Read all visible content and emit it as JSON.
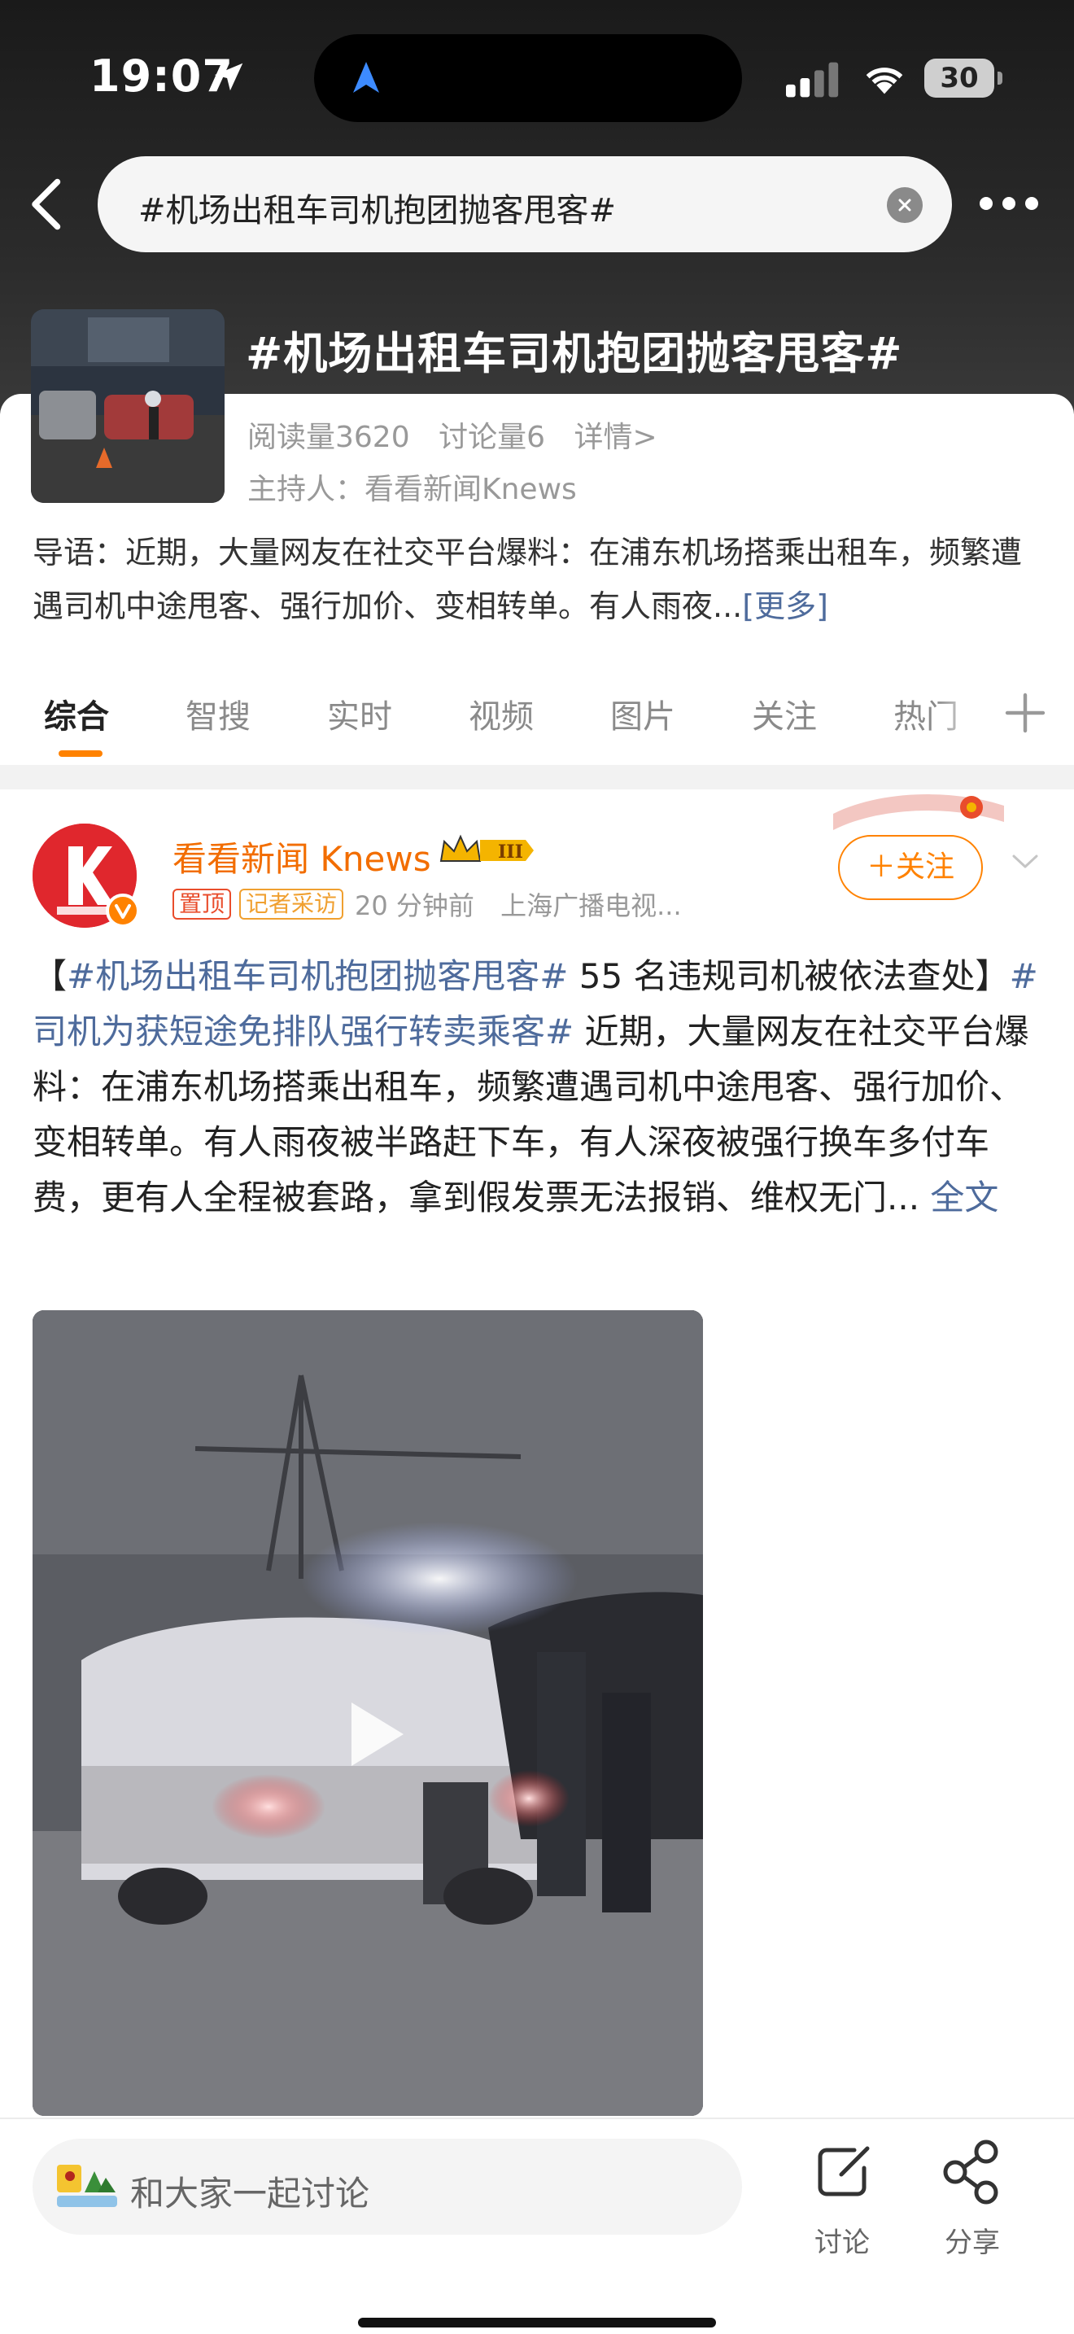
{
  "status_bar": {
    "time": "19:07",
    "battery": "30"
  },
  "search": {
    "query": "#机场出租车司机抱团抛客甩客#"
  },
  "topic": {
    "title": "#机场出租车司机抱团抛客甩客#",
    "reads": "阅读量3620",
    "discussions": "讨论量6",
    "details": "详情>",
    "host": "主持人：看看新闻Knews",
    "intro": "导语：近期，大量网友在社交平台爆料：在浦东机场搭乘出租车，频繁遭遇司机中途甩客、强行加价、变相转单。有人雨夜...",
    "more": "[更多]"
  },
  "tabs": [
    "综合",
    "智搜",
    "实时",
    "视频",
    "图片",
    "关注",
    "热门"
  ],
  "post": {
    "author": "看看新闻 Knews",
    "tag_pinned": "置顶",
    "tag_reporter": "记者采访",
    "time": "20 分钟前",
    "source": "上海广播电视...",
    "follow": "＋关注",
    "text_open": "【",
    "hashtag1": "#机场出租车司机抱团抛客甩客#",
    "text1": " 55 名违规司机被依法查处】",
    "hashtag2": "#司机为获短途免排队强行转卖乘客#",
    "text2": " 近期，大量网友在社交平台爆料：在浦东机场搭乘出租车，频繁遭遇司机中途甩客、强行加价、变相转单。有人雨夜被半路赶下车，有人深夜被强行换车多付车费，更有人全程被套路，拿到假发票无法报销、维权无门...",
    "full_text": " 全文"
  },
  "bottom_bar": {
    "comment_placeholder": "和大家一起讨论",
    "discuss": "讨论",
    "share": "分享"
  },
  "colors": {
    "accent": "#ff8200",
    "link": "#4e6b9c",
    "author": "#f26d00"
  }
}
